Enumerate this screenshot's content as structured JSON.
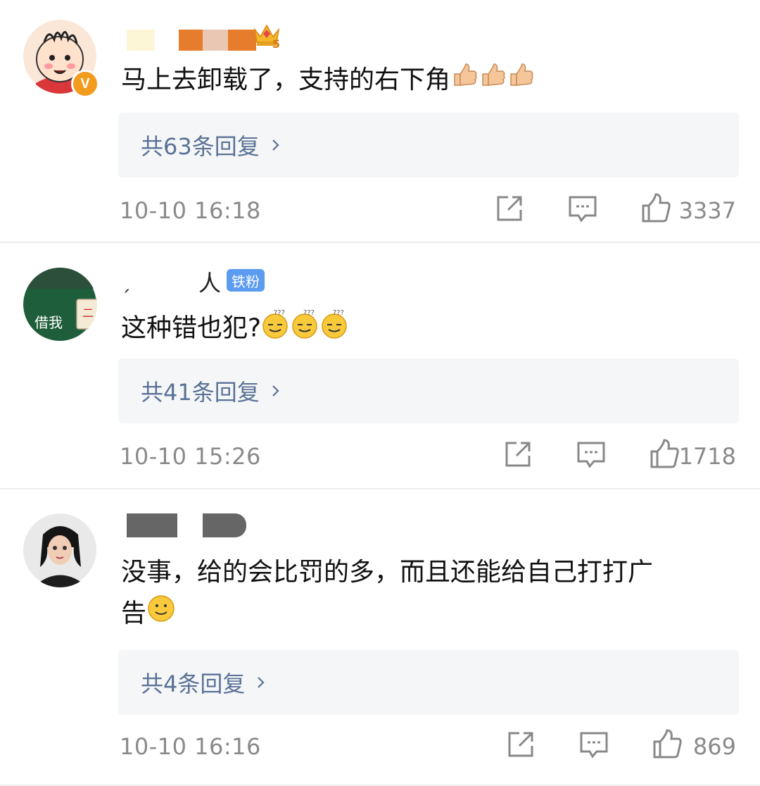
{
  "comments": [
    {
      "username": "",
      "text_line1": "马上去卸载了，支持的右下角",
      "text_line2": "",
      "emoji_name": "thumbs-up-icon",
      "replies_label": "共63条回复",
      "timestamp": "10-10 16:18",
      "likes": "3337",
      "badge": "",
      "avatar_badge": "V",
      "level_badge": "5"
    },
    {
      "username": "人",
      "text_line1": "这种错也犯?",
      "text_line2": "",
      "emoji_name": "doubt-face-icon",
      "replies_label": "共41条回复",
      "timestamp": "10-10 15:26",
      "likes": "1718",
      "badge": "铁粉",
      "avatar_text": "借我"
    },
    {
      "username": "",
      "text_line1": "没事，给的会比罚的多，而且还能给自己打打广",
      "text_line2": "告",
      "emoji_name": "smile-face-icon",
      "replies_label": "共4条回复",
      "timestamp": "10-10 16:16",
      "likes": "869",
      "badge": ""
    }
  ],
  "colors": {
    "reply_link": "#5a7297",
    "meta_gray": "#8a8a8a",
    "reply_bg": "#f5f6f7",
    "badge_blue": "#5b9bf0",
    "verified_orange": "#f29b1d"
  }
}
